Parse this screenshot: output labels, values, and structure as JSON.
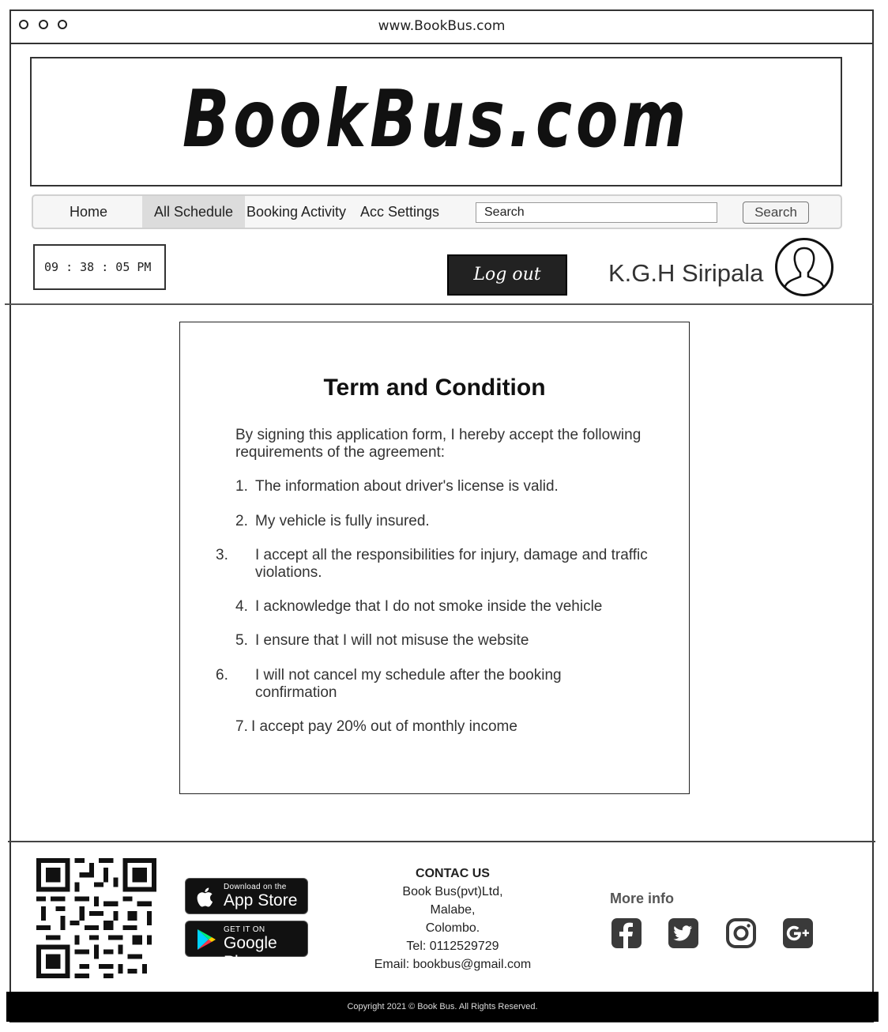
{
  "browser": {
    "url": "www.BookBus.com"
  },
  "brand": {
    "logo_text": "BookBus.com"
  },
  "nav": {
    "items": [
      {
        "label": "Home",
        "active": false
      },
      {
        "label": "All Schedule",
        "active": true
      },
      {
        "label": "Booking Activity",
        "active": false
      },
      {
        "label": "Acc Settings",
        "active": false
      }
    ],
    "search_value": "Search",
    "search_button": "Search"
  },
  "status": {
    "clock": "09 : 38 : 05 PM",
    "logout_label": "Log out",
    "user_name": "K.G.H Siripala"
  },
  "terms": {
    "title": "Term and Condition",
    "intro": "By signing this application form, I hereby accept the following requirements of the agreement:",
    "items": [
      {
        "num": "1.",
        "text": "The information about driver's license is valid."
      },
      {
        "num": "2.",
        "text": "My vehicle is fully insured."
      },
      {
        "num": "3.",
        "text": "I accept all the responsibilities for injury, damage and traffic violations."
      },
      {
        "num": "4.",
        "text": "I acknowledge that I do not smoke inside the vehicle"
      },
      {
        "num": "5.",
        "text": "I ensure that I will not misuse the website"
      },
      {
        "num": "6.",
        "text": "I will not cancel my schedule after the booking confirmation"
      },
      {
        "num": "7.",
        "text": "I accept pay 20% out of monthly income"
      }
    ]
  },
  "footer": {
    "app_store": {
      "small": "Download on the",
      "big": "App Store"
    },
    "google_play": {
      "small": "GET IT ON",
      "big": "Google Play"
    },
    "contact": {
      "heading": "CONTAC US",
      "lines": [
        "Book Bus(pvt)Ltd,",
        "Malabe,",
        "Colombo.",
        "Tel: 0112529729",
        "Email: bookbus@gmail.com"
      ]
    },
    "more_info": "More info",
    "social_icons": [
      "facebook-icon",
      "twitter-icon",
      "instagram-icon",
      "google-plus-icon"
    ],
    "copyright": "Copyright 2021 © Book Bus. All Rights Reserved."
  }
}
